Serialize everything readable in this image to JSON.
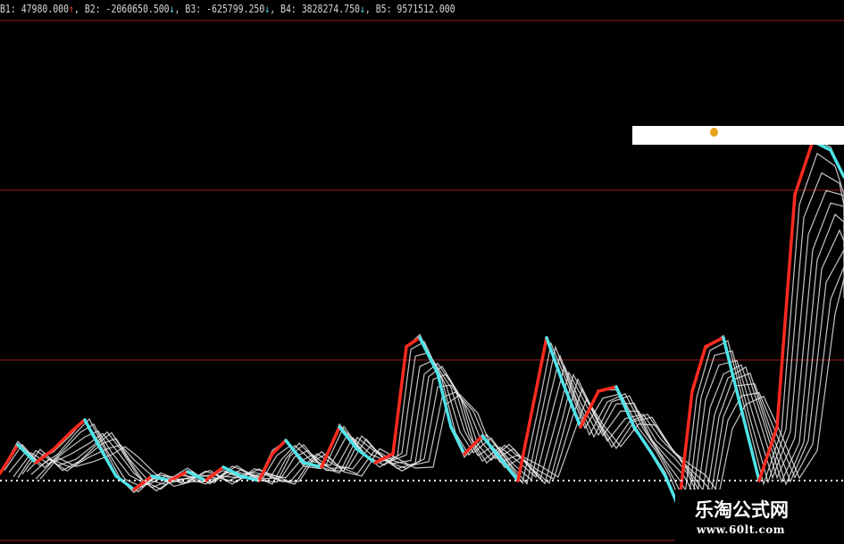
{
  "indicator_bar": {
    "items": [
      {
        "label": "B1:",
        "value": "47980.000",
        "direction": "↑",
        "trend": "up"
      },
      {
        "label": "B2:",
        "value": "-2060650.500",
        "direction": "↓",
        "trend": "down"
      },
      {
        "label": "B3:",
        "value": "-625799.250",
        "direction": "↓",
        "trend": "down"
      },
      {
        "label": "B4:",
        "value": "3828274.750",
        "direction": "↓",
        "trend": "down"
      },
      {
        "label": "B5:",
        "value": "9571512.000",
        "direction": "",
        "trend": "none"
      }
    ]
  },
  "watermark": {
    "title": "乐淘公式网",
    "url": "www.60lt.com"
  },
  "colors": {
    "background": "#000000",
    "rising": "#ff2a1f",
    "falling": "#4fe3e8",
    "ribbon": "#e6e6e6",
    "gridline": "#6b1414",
    "baseline": "#ffffff",
    "popup_bar": "#ffffff",
    "popup_dot": "#e7a21c"
  },
  "chart_data": {
    "type": "line",
    "title": "",
    "xlabel": "",
    "ylabel": "",
    "note": "Multi-strand ribbon oscillator drawn as fanned white lines; leading edge colored red on rises and cyan on falls. Values read as relative indicator levels (0 = dotted zero line).",
    "ylim": [
      -30,
      380
    ],
    "x": [
      0,
      20,
      40,
      60,
      80,
      95,
      110,
      130,
      150,
      170,
      190,
      210,
      230,
      250,
      270,
      290,
      305,
      320,
      340,
      360,
      380,
      400,
      420,
      440,
      455,
      470,
      490,
      505,
      520,
      540,
      560,
      580,
      600,
      612,
      630,
      650,
      670,
      690,
      710,
      730,
      745,
      760,
      775,
      790,
      810,
      830,
      850,
      870,
      890,
      910,
      930,
      945
    ],
    "series": [
      {
        "values": [
          8,
          40,
          20,
          35,
          55,
          68,
          40,
          5,
          -10,
          5,
          0,
          10,
          0,
          15,
          5,
          0,
          30,
          45,
          20,
          15,
          60,
          35,
          20,
          30,
          150,
          160,
          120,
          60,
          30,
          50,
          25,
          0,
          100,
          160,
          110,
          60,
          100,
          105,
          60,
          30,
          5,
          -30,
          100,
          150,
          160,
          80,
          0,
          60,
          320,
          380,
          370,
          340
        ]
      }
    ]
  }
}
